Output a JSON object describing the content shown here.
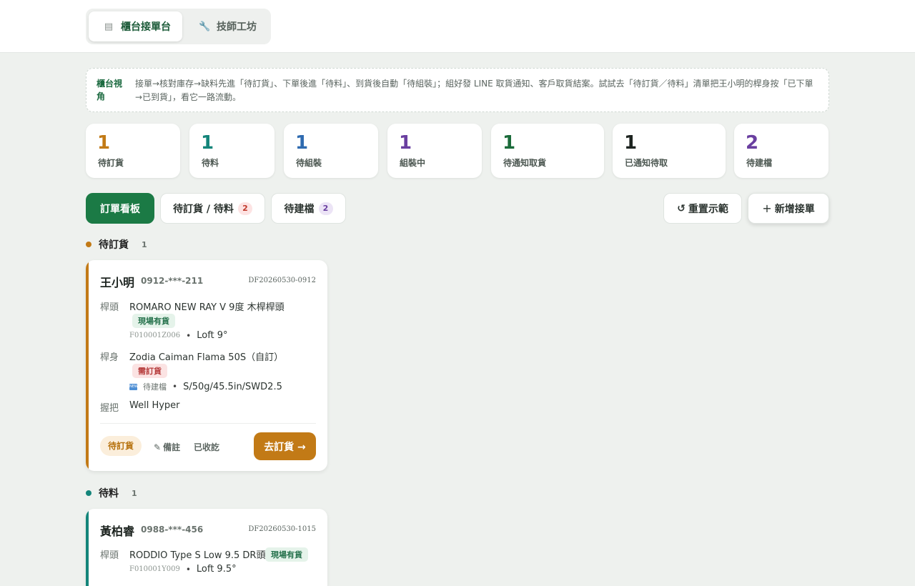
{
  "header": {
    "tabs": [
      {
        "label": "櫃台接單台",
        "icon": "document-icon"
      },
      {
        "label": "技師工坊",
        "icon": "wrench-icon"
      }
    ]
  },
  "notice": {
    "label": "櫃台視角",
    "text": "接單→核對庫存→缺料先進「待訂貨」、下單後進「待料」、到貨後自動「待組裝」；組好發 LINE 取貨通知、客戶取貨結案。試試去「待訂貨／待料」清單把王小明的桿身按「已下單→已到貨」，看它一路流動。"
  },
  "stats": [
    {
      "value": "1",
      "label": "待訂貨",
      "color": "#c27a16"
    },
    {
      "value": "1",
      "label": "待料",
      "color": "#14857a"
    },
    {
      "value": "1",
      "label": "待組裝",
      "color": "#2f6bb0"
    },
    {
      "value": "1",
      "label": "組裝中",
      "color": "#6a3fa0"
    },
    {
      "value": "1",
      "label": "待通知取貨",
      "color": "#1b6b3a"
    },
    {
      "value": "1",
      "label": "已通知待取",
      "color": "#1d2420"
    },
    {
      "value": "2",
      "label": "待建檔",
      "color": "#6a3fa0"
    }
  ],
  "tabs": {
    "board": "訂單看板",
    "pending": "待訂貨 / 待料",
    "pending_count": "2",
    "register": "待建檔",
    "register_count": "2"
  },
  "actions": {
    "reset": "重置示範",
    "reset_icon": "↺",
    "new_order": "新增接單",
    "new_icon": "+"
  },
  "columns": [
    {
      "title": "待訂貨",
      "count": "1",
      "color": "#c27a16",
      "card": {
        "name": "王小明",
        "phone": "0912-***-211",
        "order_no": "DF20260530-0912",
        "head_label": "桿頭",
        "head_value": "ROMARO NEW RAY V 9度 木桿桿頭",
        "head_tag": "現場有貨",
        "head_code": "F010001Z006",
        "head_spec": "Loft 9°",
        "shaft_label": "桿身",
        "shaft_value": "Zodia Caiman Flama 50S（自訂）",
        "shaft_tag": "需訂貨",
        "shaft_new": "NEW",
        "shaft_pending": "待建檔",
        "shaft_spec": "S/50g/45.5in/SWD2.5",
        "grip_label": "握把",
        "grip_value": "Well Hyper",
        "status": "待訂貨",
        "note": "備註",
        "paid": "已收訖",
        "action": "去訂貨 →"
      }
    },
    {
      "title": "待料",
      "count": "1",
      "color": "#14857a",
      "card": {
        "name": "黃柏睿",
        "phone": "0988-***-456",
        "order_no": "DF20260530-1015",
        "head_label": "桿頭",
        "head_value": "RODDIO Type S Low 9.5 DR頭",
        "head_tag": "現場有貨",
        "head_code": "F010001Y009",
        "head_spec": "Loft 9.5°"
      }
    }
  ]
}
